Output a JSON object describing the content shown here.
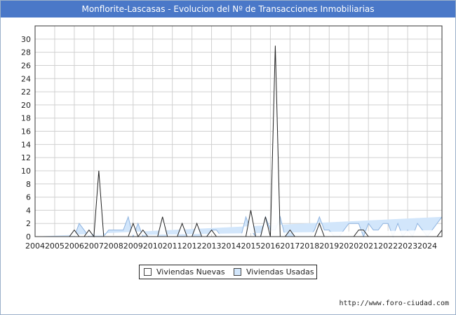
{
  "header": {
    "title": "Monflorite-Lascasas - Evolucion del Nº de Transacciones Inmobiliarias"
  },
  "footer": {
    "source": "http://www.foro-ciudad.com"
  },
  "colors": {
    "title_bar": "#4a78c8",
    "nuevas_fill": "#ffffff",
    "nuevas_line": "#222222",
    "usadas_fill": "#d2e6fb",
    "usadas_line": "#8fb4e0",
    "grid": "#d0d0d0"
  },
  "chart_data": {
    "type": "area",
    "title": "Monflorite-Lascasas - Evolucion del Nº de Transacciones Inmobiliarias",
    "xlabel": "",
    "ylabel": "",
    "x_unit": "quarter",
    "xlim": [
      2004,
      2024.75
    ],
    "ylim": [
      0,
      32
    ],
    "yticks": [
      0,
      2,
      4,
      6,
      8,
      10,
      12,
      14,
      16,
      18,
      20,
      22,
      24,
      26,
      28,
      30
    ],
    "xticks": [
      "2004",
      "2005",
      "2006",
      "2007",
      "2008",
      "2009",
      "2010",
      "2011",
      "2012",
      "2013",
      "2014",
      "2015",
      "2016",
      "2017",
      "2018",
      "2019",
      "2020",
      "2021",
      "2022",
      "2023",
      "2024"
    ],
    "grid": true,
    "legend_position": "bottom-center",
    "x": [
      2004.0,
      2004.25,
      2004.5,
      2004.75,
      2005.0,
      2005.25,
      2005.5,
      2005.75,
      2006.0,
      2006.25,
      2006.5,
      2006.75,
      2007.0,
      2007.25,
      2007.5,
      2007.75,
      2008.0,
      2008.25,
      2008.5,
      2008.75,
      2009.0,
      2009.25,
      2009.5,
      2009.75,
      2010.0,
      2010.25,
      2010.5,
      2010.75,
      2011.0,
      2011.25,
      2011.5,
      2011.75,
      2012.0,
      2012.25,
      2012.5,
      2012.75,
      2013.0,
      2013.25,
      2013.5,
      2013.75,
      2014.0,
      2014.25,
      2014.5,
      2014.75,
      2015.0,
      2015.25,
      2015.5,
      2015.75,
      2016.0,
      2016.25,
      2016.5,
      2016.75,
      2017.0,
      2017.25,
      2017.5,
      2017.75,
      2018.0,
      2018.25,
      2018.5,
      2018.75,
      2019.0,
      2019.25,
      2019.5,
      2019.75,
      2020.0,
      2020.25,
      2020.5,
      2020.75,
      2021.0,
      2021.25,
      2021.5,
      2021.75,
      2022.0,
      2022.25,
      2022.5,
      2022.75,
      2023.0,
      2023.25,
      2023.5,
      2023.75,
      2024.0,
      2024.25,
      2024.5,
      2024.75
    ],
    "series": [
      {
        "name": "Viviendas Usadas",
        "values": [
          0,
          0,
          0,
          0,
          0,
          0,
          0,
          0,
          0,
          2,
          1,
          0,
          0,
          0,
          0,
          1,
          1,
          1,
          1,
          3,
          0,
          2,
          0,
          0,
          0,
          0,
          0,
          0,
          0,
          0,
          0,
          0,
          0,
          0,
          0,
          0,
          1,
          1,
          0,
          0,
          0,
          0,
          0,
          3,
          1,
          0,
          0,
          3,
          1,
          1,
          3,
          0,
          0,
          0,
          0,
          0,
          0,
          1,
          3,
          1,
          1,
          0,
          0,
          1,
          2,
          2,
          2,
          0,
          2,
          1,
          1,
          2,
          2,
          0,
          2,
          0,
          1,
          0,
          2,
          1,
          0,
          1,
          2,
          3,
          1,
          1,
          1
        ]
      },
      {
        "name": "Viviendas Nuevas",
        "values": [
          0,
          0,
          0,
          0,
          0,
          0,
          0,
          0,
          1,
          0,
          0,
          1,
          0,
          10,
          0,
          0,
          0,
          0,
          0,
          0,
          2,
          0,
          1,
          0,
          0,
          0,
          3,
          0,
          0,
          0,
          2,
          0,
          0,
          2,
          0,
          0,
          1,
          0,
          0,
          0,
          0,
          0,
          0,
          0,
          4,
          0,
          0,
          3,
          0,
          29,
          0,
          0,
          1,
          0,
          0,
          0,
          0,
          0,
          2,
          0,
          0,
          0,
          0,
          0,
          0,
          0,
          1,
          1,
          0,
          0,
          0,
          0,
          0,
          0,
          0,
          0,
          0,
          0,
          0,
          0,
          0,
          0,
          0,
          1,
          0,
          0,
          0
        ]
      }
    ]
  },
  "legend": {
    "nuevas_label": "Viviendas Nuevas",
    "usadas_label": "Viviendas Usadas"
  }
}
